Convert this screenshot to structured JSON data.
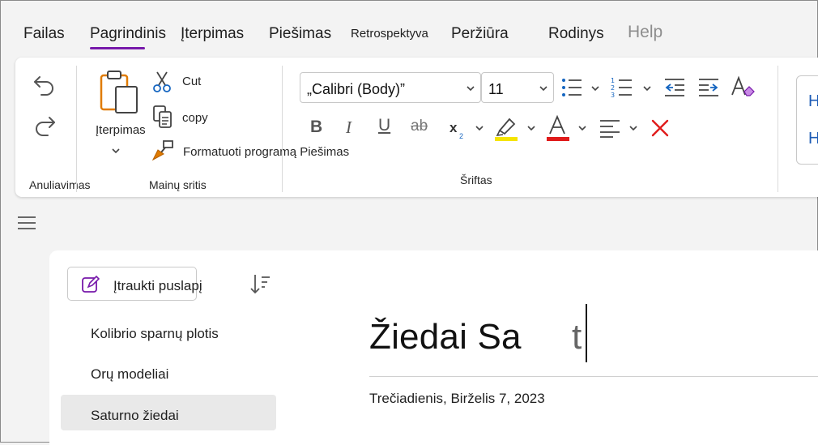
{
  "tabs": [
    {
      "label": "Failas"
    },
    {
      "label": "Pagrindinis",
      "active": true
    },
    {
      "label": "Įterpimas"
    },
    {
      "label": "Piešimas"
    },
    {
      "label": "Retrospektyva"
    },
    {
      "label": "Peržiūra"
    },
    {
      "label": "Rodinys"
    },
    {
      "label": "Help",
      "disabled": true
    }
  ],
  "ribbon": {
    "undo_group_label": "Anuliavimas",
    "clipboard": {
      "paste_label": "Įterpimas",
      "cut_label": "Cut",
      "copy_label": "copy",
      "format_painter_label": "Formatuoti programą Piešimas",
      "group_label": "Mainų sritis"
    },
    "font": {
      "font_name": "„Calibri (Body)”",
      "font_size": "11",
      "group_label": "Šriftas",
      "highlight_color": "#f5e400",
      "font_color": "#e01b1b"
    },
    "styles_preview": [
      "H",
      "H"
    ]
  },
  "sidebar": {
    "add_page_label": "Įtraukti puslapį",
    "pages": [
      {
        "title": "Kolibrio sparnų plotis"
      },
      {
        "title": "Orų modeliai"
      },
      {
        "title": "Saturno žiedai",
        "selected": true
      }
    ]
  },
  "page": {
    "title": "Žiedai Sa",
    "title_tail": "t",
    "date": "Trečiadienis, Birželis 7, 2023"
  },
  "colors": {
    "accent": "#7719aa",
    "icon_blue": "#1565c0",
    "delete_red": "#e01b1b"
  }
}
